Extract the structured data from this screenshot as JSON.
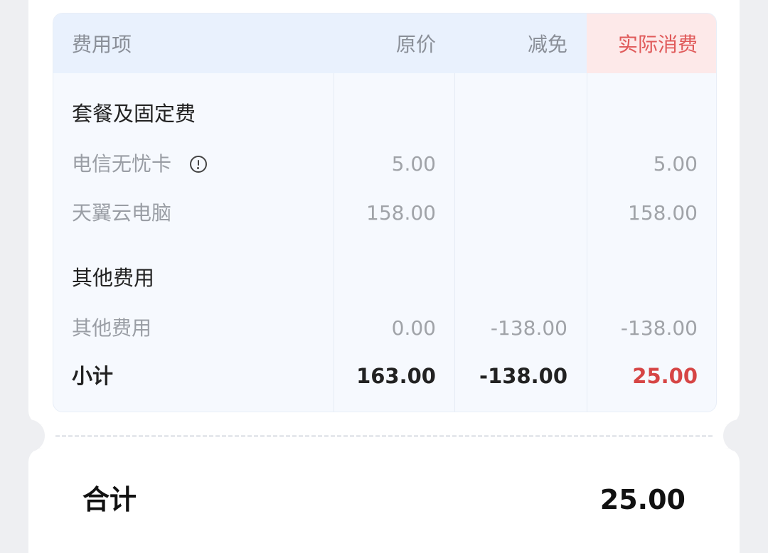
{
  "header": {
    "item_col": "费用项",
    "original_col": "原价",
    "discount_col": "减免",
    "actual_col": "实际消费"
  },
  "sections": [
    {
      "title": "套餐及固定费",
      "items": [
        {
          "name": "电信无忧卡",
          "original": "5.00",
          "discount": "",
          "actual": "5.00",
          "icon": "info-icon"
        },
        {
          "name": "天翼云电脑",
          "original": "158.00",
          "discount": "",
          "actual": "158.00"
        }
      ]
    },
    {
      "title": "其他费用",
      "items": [
        {
          "name": "其他费用",
          "original": "0.00",
          "discount": "-138.00",
          "actual": "-138.00"
        }
      ]
    }
  ],
  "subtotal": {
    "label": "小计",
    "original": "163.00",
    "discount": "-138.00",
    "actual": "25.00"
  },
  "total": {
    "label": "合计",
    "value": "25.00"
  },
  "colors": {
    "accent_red": "#d64545",
    "header_blue": "#e9f1fd",
    "header_pink": "#fde9e9"
  }
}
